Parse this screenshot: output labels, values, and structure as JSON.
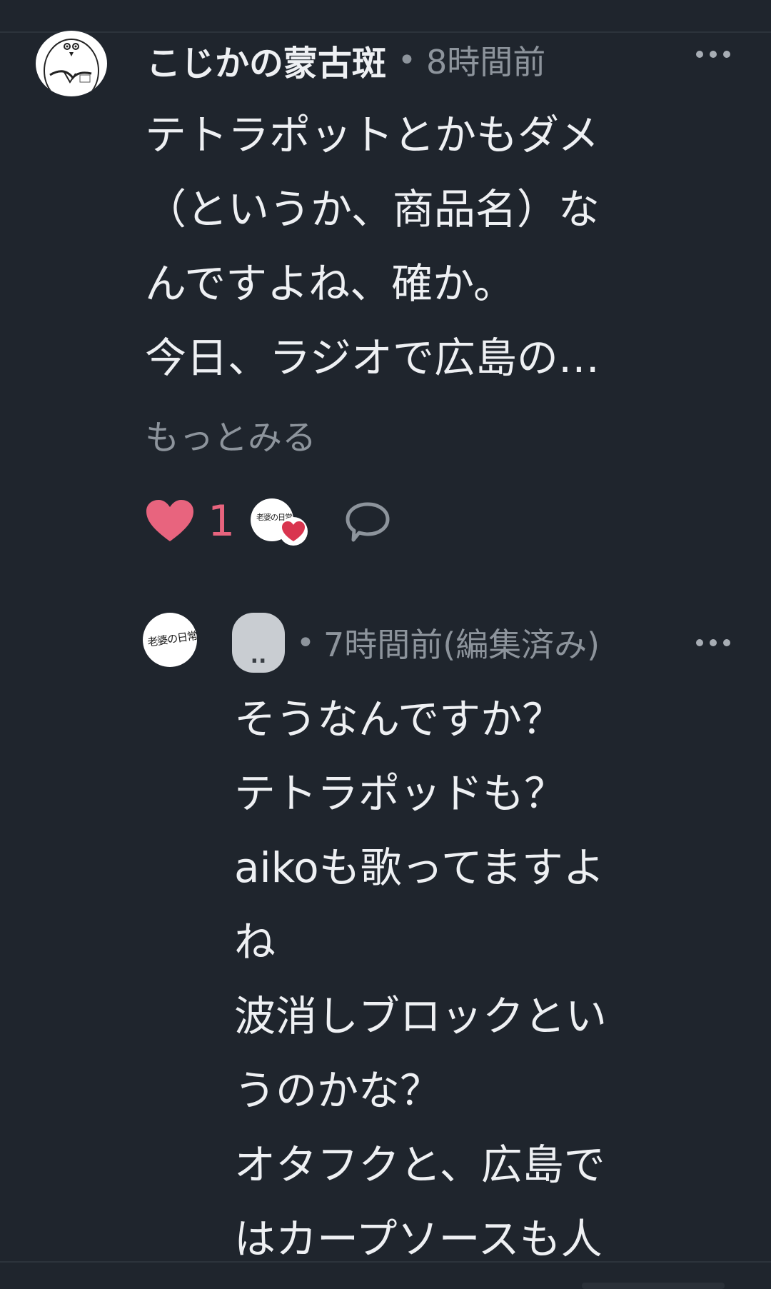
{
  "comment": {
    "author": "こじかの蒙古斑",
    "separator": "•",
    "time": "8時間前",
    "body_lines": [
      "テトラポットとかもダメ",
      "（というか、商品名）な",
      "んですよね、確か。",
      "今日、ラジオで広島の…"
    ],
    "see_more": "もっとみる",
    "like_count": "1",
    "liker_avatar_text": "老婆の日常",
    "icons": {
      "more": "more-horizontal-icon",
      "like": "heart-icon",
      "reply": "comment-bubble-icon"
    },
    "colors": {
      "like": "#e8647e",
      "muted_text": "#8d949c",
      "background": "#1f252d"
    }
  },
  "reply": {
    "avatar_text": "老婆の日常散歩",
    "author": "..",
    "separator": "•",
    "time": "7時間前(編集済み)",
    "body_lines": [
      "そうなんですか？",
      "テトラポッドも？",
      "aikoも歌ってますよ",
      "ね",
      "波消しブロックとい",
      "うのかな？",
      "オタフクと、広島で",
      "はカープソースも人"
    ]
  }
}
